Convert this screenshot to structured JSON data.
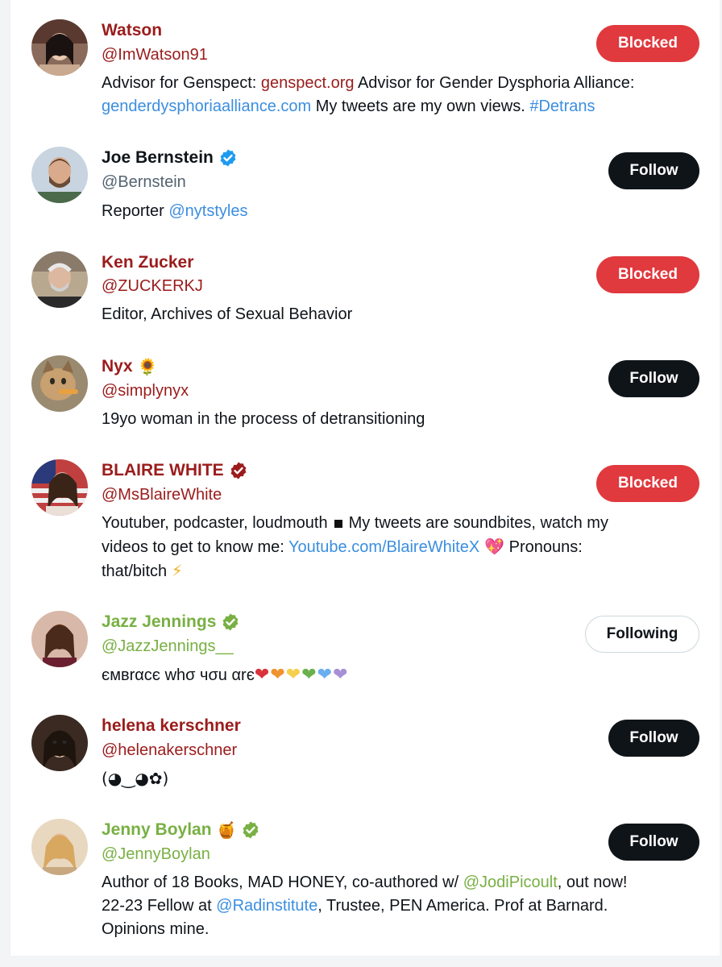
{
  "users": [
    {
      "name": "Watson",
      "handle": "@ImWatson91",
      "button": "Blocked",
      "bio": {
        "t1": "Advisor for Genspect: ",
        "link1": "genspect.org",
        "t2": " Advisor for Gender Dysphoria Alliance:",
        "link2": "genderdysphoriaalliance.com",
        "t3": " My tweets are my own views. ",
        "hashtag": "#Detrans"
      }
    },
    {
      "name": "Joe Bernstein",
      "handle": "@Bernstein",
      "button": "Follow",
      "bio": {
        "t1": "Reporter ",
        "link1": "@nytstyles"
      }
    },
    {
      "name": "Ken Zucker",
      "handle": "@ZUCKERKJ",
      "button": "Blocked",
      "bio": {
        "t1": "Editor, Archives of Sexual Behavior"
      }
    },
    {
      "name": "Nyx",
      "name_emoji": "🌻",
      "handle": "@simplynyx",
      "button": "Follow",
      "bio": {
        "t1": "19yo woman in the process of detransitioning"
      }
    },
    {
      "name": "BLAIRE WHITE",
      "handle": "@MsBlaireWhite",
      "button": "Blocked",
      "bio": {
        "t1": "Youtuber, podcaster, loudmouth",
        "t2": "My tweets are soundbites, watch my",
        "t3": "videos to get to know me: ",
        "link1": "Youtube.com/BlaireWhiteX",
        "emoji1": "💖",
        "t4": " Pronouns:",
        "t5": "that/bitch ",
        "emoji2": "⚡"
      }
    },
    {
      "name": "Jazz Jennings",
      "handle": "@JazzJennings__",
      "button": "Following",
      "bio": {
        "t1": "ємвrαcє whσ чσu αrє",
        "hearts": [
          "❤",
          "❤",
          "❤",
          "❤",
          "❤",
          "❤"
        ]
      }
    },
    {
      "name": "helena kerschner",
      "handle": "@helenakerschner",
      "button": "Follow",
      "bio": {
        "t1": "(◕‿◕✿)"
      }
    },
    {
      "name": "Jenny Boylan",
      "name_emoji": "🍯",
      "handle": "@JennyBoylan",
      "button": "Follow",
      "bio": {
        "t1": "Author of 18 Books, MAD HONEY, co-authored w/ ",
        "link1": "@JodiPicoult",
        "t2": ", out now!",
        "t3": "22-23 Fellow at ",
        "link2": "@Radinstitute",
        "t4": ", Trustee, PEN America. Prof at Barnard.",
        "t5": "Opinions mine."
      }
    }
  ],
  "colors": {
    "blocked_name": "#9b1c1c",
    "following_name": "#78b043",
    "normal_name": "#0f1419",
    "blocked_button": "#e0393e",
    "follow_button": "#0f1419",
    "link_blue": "#3b8ee0",
    "verified_blue": "#1d9bf0",
    "verified_green": "#78b043",
    "verified_red": "#9b1c1c"
  },
  "heart_colors": [
    "#d9323a",
    "#f0922e",
    "#f5cf4d",
    "#6ab04c",
    "#6aaef0",
    "#a98fd6"
  ]
}
